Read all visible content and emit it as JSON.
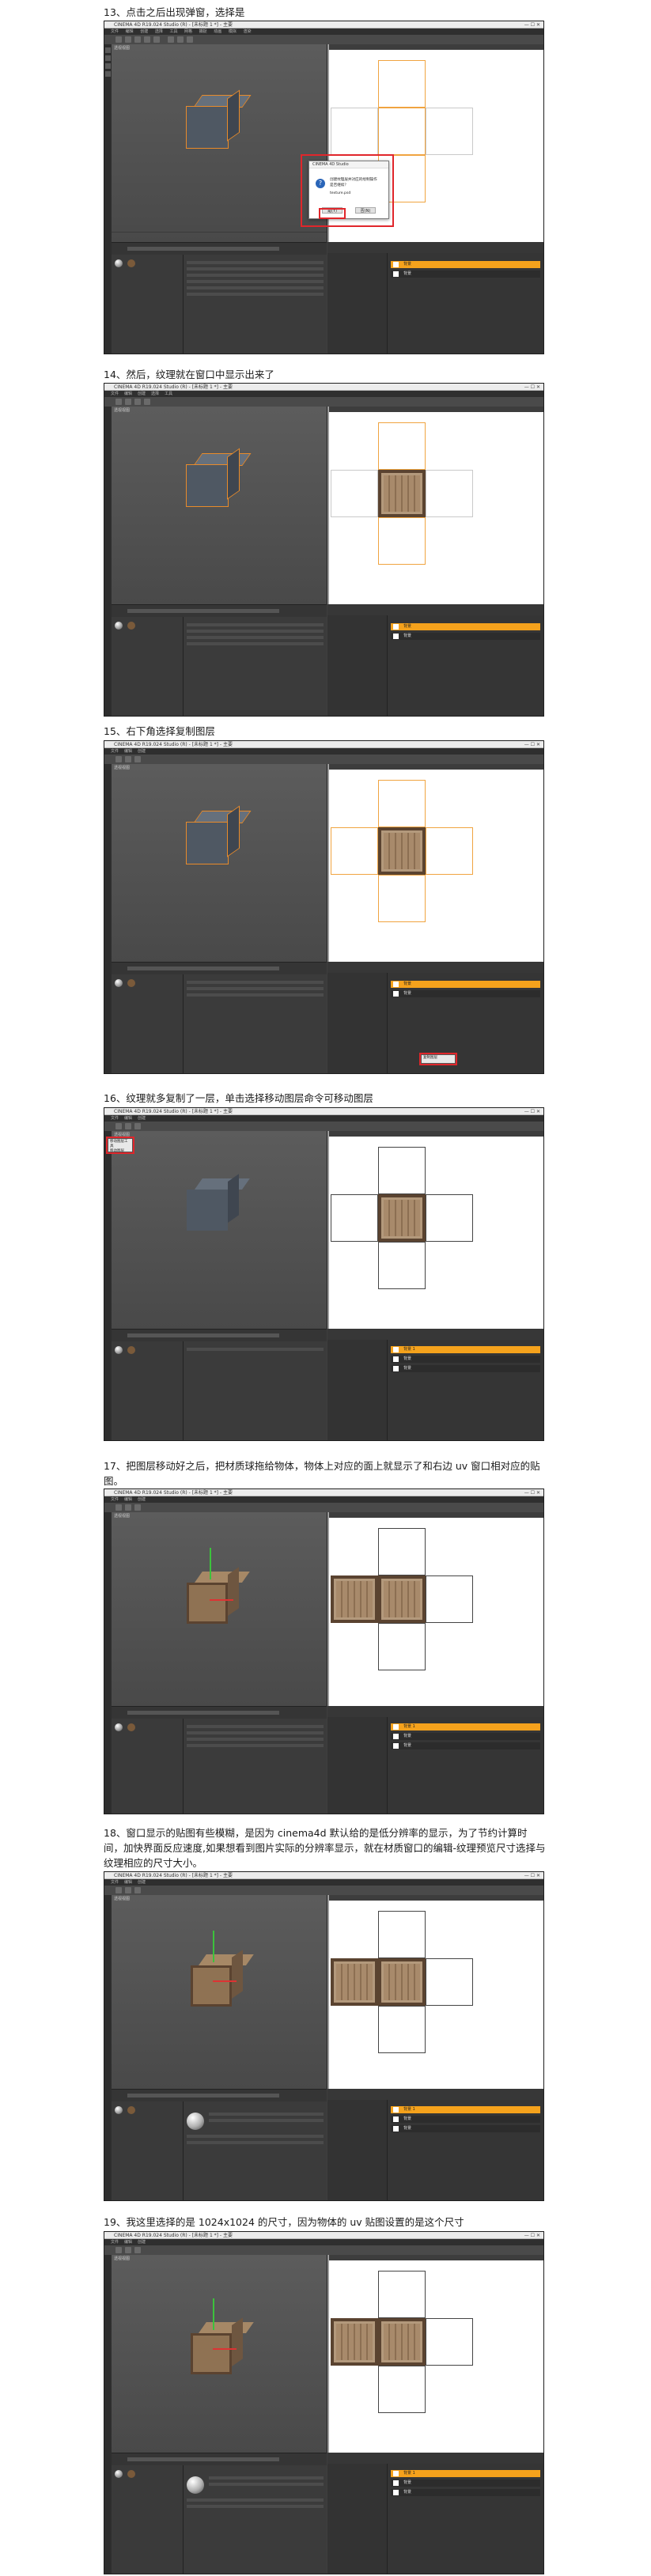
{
  "steps": [
    {
      "id": 13,
      "caption": "13、点击之后出现弹窗，选择是"
    },
    {
      "id": 14,
      "caption": "14、然后，纹理就在窗口中显示出来了"
    },
    {
      "id": 15,
      "caption": "15、右下角选择复制图层"
    },
    {
      "id": 16,
      "caption": "16、纹理就多复制了一层，单击选择移动图层命令可移动图层"
    },
    {
      "id": 17,
      "caption": "17、把图层移动好之后，把材质球拖给物体，物体上对应的面上就显示了和右边 uv 窗口相对应的贴图。"
    },
    {
      "id": 18,
      "caption": "18、窗口显示的贴图有些模糊，是因为 cinema4d 默认给的是低分辨率的显示，为了节约计算时间，加快界面反应速度,如果想看到图片实际的分辨率显示，就在材质窗口的编辑-纹理预览尺寸选择与纹理相应的尺寸大小。"
    },
    {
      "id": 19,
      "caption": "19、我这里选择的是 1024x1024 的尺寸，因为物体的 uv 贴图设置的是这个尺寸"
    }
  ],
  "app": {
    "window_title": "CINEMA 4D R19.024 Studio (R) - [未标题 1 *] - 主要",
    "menu": [
      "文件",
      "编辑",
      "创建",
      "选择",
      "工具",
      "网格",
      "捕捉",
      "动画",
      "模拟",
      "渲染",
      "雕刻",
      "运动跟踪",
      "运动图形",
      "角色",
      "流水线",
      "插件",
      "脚本",
      "窗口",
      "帮助"
    ],
    "viewport_label": "透视视图"
  },
  "dialog": {
    "title": "CINEMA 4D Studio",
    "message": "创建纹理层并对应的绘制操作是否继续？",
    "filename": "texture.psd",
    "yes_label": "是(Y)",
    "no_label": "否(N)"
  },
  "layers": {
    "layer_active": "背景",
    "layer_copy": "背景 1",
    "layer_bg": "背景"
  },
  "popups": {
    "copy_layer": "复制图层",
    "move_layer_tool": "移动图层工具",
    "move_layer_hint": "移动图层"
  },
  "colors": {
    "highlight_box": "#e0262b",
    "active_layer": "#f5a21c",
    "selection_outline": "#e98b2a"
  }
}
